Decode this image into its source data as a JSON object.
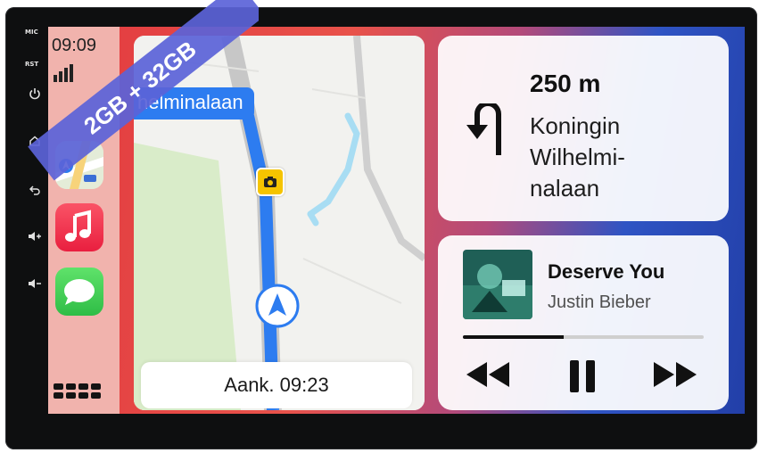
{
  "device": {
    "side_labels": {
      "mic": "MIC",
      "rst": "RST"
    },
    "side_icons": [
      "power-icon",
      "home-icon",
      "back-icon",
      "volume-up-icon",
      "volume-down-icon"
    ]
  },
  "promo_badge": {
    "text": "2GB + 32GB",
    "color": "#5b63d8"
  },
  "status": {
    "time": "09:09"
  },
  "dock": {
    "apps": [
      {
        "name": "Maps",
        "icon": "maps-icon"
      },
      {
        "name": "Music",
        "icon": "music-note-icon"
      },
      {
        "name": "Messages",
        "icon": "chat-bubble-icon"
      }
    ],
    "menu_icon": "app-grid-icon"
  },
  "map": {
    "street_label": "helminalaan",
    "eta_label": "Aank. 09:23",
    "route_color": "#2d7cf0"
  },
  "navigation": {
    "distance": "250 m",
    "street_lines": [
      "Koningin",
      "Wilhelmi-",
      "nalaan"
    ],
    "maneuver_icon": "u-turn-icon"
  },
  "now_playing": {
    "title": "Deserve You",
    "artist": "Justin Bieber",
    "progress": 0.42,
    "controls": [
      "rewind-icon",
      "pause-icon",
      "fast-forward-icon"
    ]
  },
  "colors": {
    "accent_blue": "#2d7cf0",
    "dock_bg": "#f1b3ad",
    "music_red": "#f4364c",
    "messages_green": "#38c94d",
    "camera_yellow": "#f5c400"
  }
}
